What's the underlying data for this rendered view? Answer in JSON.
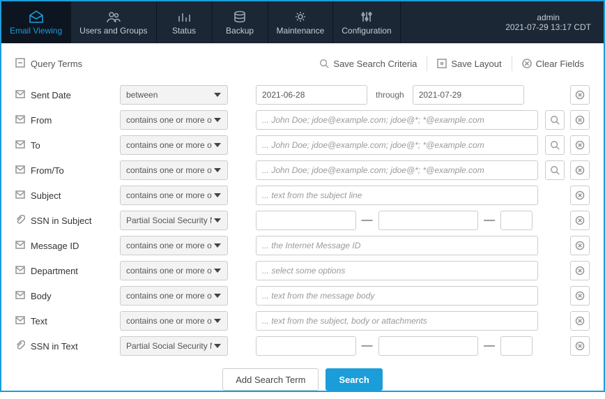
{
  "nav": {
    "items": [
      {
        "label": "Email Viewing"
      },
      {
        "label": "Users and Groups"
      },
      {
        "label": "Status"
      },
      {
        "label": "Backup"
      },
      {
        "label": "Maintenance"
      },
      {
        "label": "Configuration"
      }
    ],
    "user": "admin",
    "timestamp": "2021-07-29 13:17 CDT"
  },
  "toolbar": {
    "query_terms": "Query Terms",
    "save_search": "Save Search Criteria",
    "save_layout": "Save Layout",
    "clear_fields": "Clear Fields"
  },
  "ops": {
    "between": "between",
    "contains": "contains one or more of",
    "ssn": "Partial Social Security Number"
  },
  "labels": {
    "sent_date": "Sent Date",
    "from": "From",
    "to": "To",
    "from_to": "From/To",
    "subject": "Subject",
    "ssn_subject": "SSN in Subject",
    "message_id": "Message ID",
    "department": "Department",
    "body": "Body",
    "text": "Text",
    "ssn_text": "SSN in Text"
  },
  "values": {
    "date_from": "2021-06-28",
    "date_through_label": "through",
    "date_to": "2021-07-29"
  },
  "placeholders": {
    "addr": "... John Doe; jdoe@example.com; jdoe@*; *@example.com",
    "subject": "... text from the subject line",
    "message_id": "... the Internet Message ID",
    "department": "... select some options",
    "body": "... text from the message body",
    "text": "... text from the subject, body or attachments"
  },
  "actions": {
    "add_term": "Add Search Term",
    "search": "Search"
  }
}
